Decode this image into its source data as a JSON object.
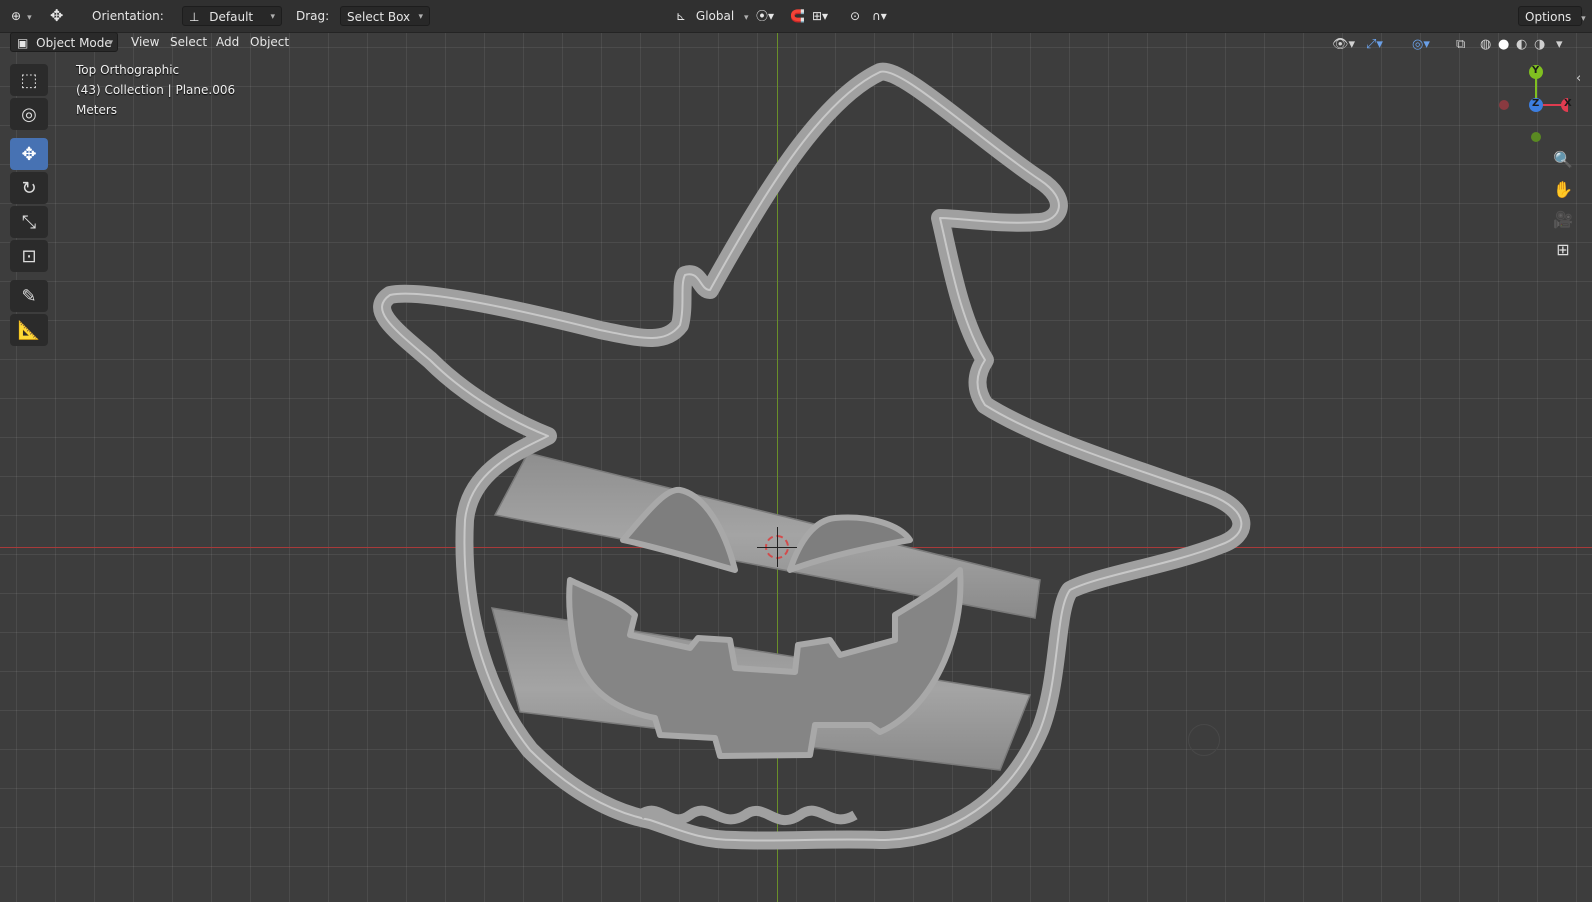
{
  "header": {
    "orientation_label": "Orientation:",
    "orientation_value": "Default",
    "drag_label": "Drag:",
    "drag_value": "Select Box",
    "transform_space": "Global",
    "options_label": "Options"
  },
  "viewport_header": {
    "mode": "Object Mode",
    "menus": [
      "View",
      "Select",
      "Add",
      "Object"
    ]
  },
  "overlay": {
    "view_name": "Top Orthographic",
    "collection": "(43) Collection | Plane.006",
    "units": "Meters"
  },
  "gizmo": {
    "y_label": "Y",
    "z_label": "Z",
    "x_label": "X",
    "colors": {
      "x": "#e03c50",
      "y": "#80c020",
      "z": "#3c7ee0"
    }
  },
  "tools": [
    {
      "icon": "select-box-icon"
    },
    {
      "icon": "cursor-icon"
    },
    {
      "icon": "move-icon",
      "active": true
    },
    {
      "icon": "rotate-icon"
    },
    {
      "icon": "scale-icon"
    },
    {
      "icon": "transform-icon"
    },
    {
      "icon": "annotate-icon"
    },
    {
      "icon": "measure-icon"
    }
  ],
  "colors": {
    "accent": "#4772b3",
    "x_axis": "#a83a3a",
    "y_axis": "#6a8f2a",
    "model": "#9a9a9a"
  }
}
